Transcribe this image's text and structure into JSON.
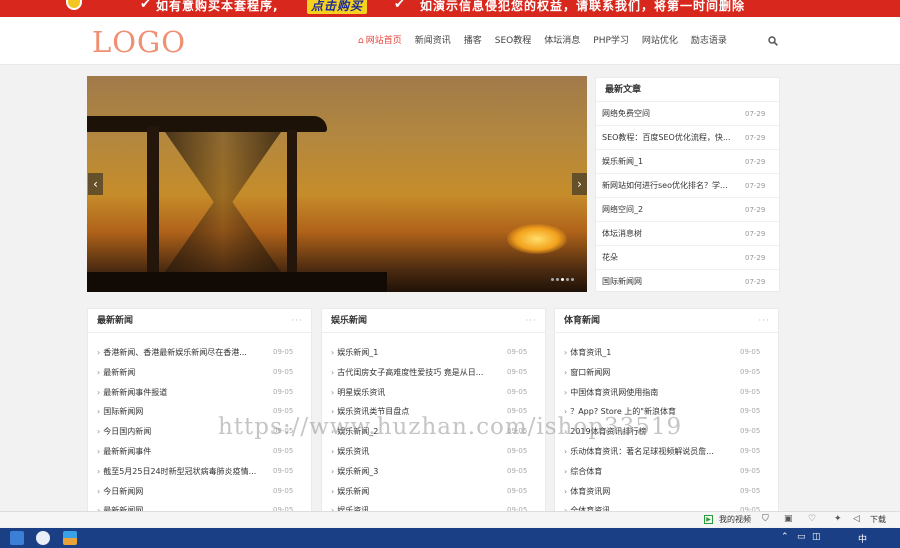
{
  "banner": {
    "text1": "如有意购买本套程序,",
    "buy_label": "点击购买",
    "text2": "如演示信息侵犯您的权益，请联系我们，将第一时间删除",
    "check_icon": "check-icon"
  },
  "header": {
    "logo": "LOGO",
    "nav": [
      "网站首页",
      "新闻资讯",
      "播客",
      "SEO教程",
      "体坛消息",
      "PHP学习",
      "网站优化",
      "励志语录"
    ],
    "active_index": 0,
    "accent_color": "#e5413a",
    "logo_color": "#f18f72",
    "search_icon": "search-icon"
  },
  "slider": {
    "prev_icon": "chevron-left-icon",
    "next_icon": "chevron-right-icon",
    "prev_label": "‹",
    "next_label": "›",
    "dots": 5,
    "active_dot": 2
  },
  "latest": {
    "title": "最新文章",
    "items": [
      {
        "title": "网络免费空间",
        "date": "07-29"
      },
      {
        "title": "SEO教程：百度SEO优化流程，快...",
        "date": "07-29"
      },
      {
        "title": "娱乐新闻_1",
        "date": "07-29"
      },
      {
        "title": "新网站如何进行seo优化排名？学...",
        "date": "07-29"
      },
      {
        "title": "网络空间_2",
        "date": "07-29"
      },
      {
        "title": "体坛消息树",
        "date": "07-29"
      },
      {
        "title": "花朵",
        "date": "07-29"
      },
      {
        "title": "国际新闻网",
        "date": "07-29"
      }
    ]
  },
  "categories": [
    {
      "title": "最新新闻",
      "more": "···",
      "items": [
        {
          "title": "香港新闻、香港最新娱乐新闻尽在香港...",
          "date": "09-05"
        },
        {
          "title": "最新新闻",
          "date": "09-05"
        },
        {
          "title": "最新新闻事件报道",
          "date": "09-05"
        },
        {
          "title": "国际新闻网",
          "date": "09-05"
        },
        {
          "title": "今日国内新闻",
          "date": "09-05"
        },
        {
          "title": "最新新闻事件",
          "date": "09-05"
        },
        {
          "title": "截至5月25日24时新型冠状病毒肺炎疫情...",
          "date": "09-05"
        },
        {
          "title": "今日新闻网",
          "date": "09-05"
        },
        {
          "title": "最新新闻网",
          "date": "09-05"
        }
      ]
    },
    {
      "title": "娱乐新闻",
      "more": "···",
      "items": [
        {
          "title": "娱乐新闻_1",
          "date": "09-05"
        },
        {
          "title": "古代闺房女子高难度性爱技巧 竟是从日...",
          "date": "09-05"
        },
        {
          "title": "明星娱乐资讯",
          "date": "09-05"
        },
        {
          "title": "娱乐资讯类节目盘点",
          "date": "09-05"
        },
        {
          "title": "娱乐新闻_2",
          "date": "09-05"
        },
        {
          "title": "娱乐资讯",
          "date": "09-05"
        },
        {
          "title": "娱乐新闻_3",
          "date": "09-05"
        },
        {
          "title": "娱乐新闻",
          "date": "09-05"
        },
        {
          "title": "娱乐资讯",
          "date": "09-05"
        }
      ]
    },
    {
      "title": "体育新闻",
      "more": "···",
      "items": [
        {
          "title": "体育资讯_1",
          "date": "09-05"
        },
        {
          "title": "窗口新闻网",
          "date": "09-05"
        },
        {
          "title": "中国体育资讯网使用指南",
          "date": "09-05"
        },
        {
          "title": "？App? Store 上的\"新浪体育",
          "date": "09-05"
        },
        {
          "title": "2019体育资讯排行榜",
          "date": "09-05"
        },
        {
          "title": "乐动体育资讯：著名足球视频解说员詹...",
          "date": "09-05"
        },
        {
          "title": "综合体育",
          "date": "09-05"
        },
        {
          "title": "体育资讯网",
          "date": "09-05"
        },
        {
          "title": "全体育资讯",
          "date": "09-05"
        }
      ]
    }
  ],
  "watermark": "https://www.huzhan.com/ishop33519",
  "statusbar": {
    "video_label": "我的视频",
    "download_label": "下载",
    "play_icon": "play-icon",
    "icons": [
      "shield-icon",
      "monitor-icon",
      "heart-icon",
      "pin-icon",
      "speaker-icon"
    ]
  },
  "taskbar": {
    "apps": [
      "file-icon",
      "app-icon",
      "app-icon-2"
    ],
    "tray_ime": "中",
    "tray_icons": [
      "chevron-up-icon",
      "network-icon",
      "volume-icon"
    ]
  }
}
